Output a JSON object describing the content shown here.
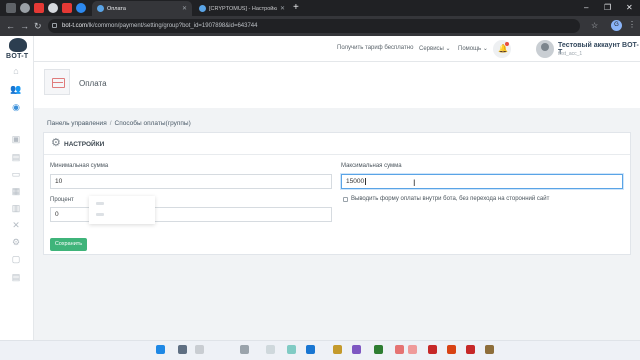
{
  "browser": {
    "tabs": [
      {
        "label": "Оплата",
        "active": true
      },
      {
        "label": "[CRYPTOMUS] - Настройка опл",
        "active": false
      }
    ],
    "url_host": "bot-t.com",
    "url_path": "/lk/common/payment/setting/group?bot_id=1907898&id=643744",
    "profile_initial": "G"
  },
  "sidebar": {
    "logo": "BOT-T",
    "icons": [
      "dashboard-icon",
      "users-icon",
      "globe-icon",
      "briefcase-icon",
      "document-icon",
      "layout-icon",
      "gift-icon",
      "chart-icon",
      "tools-icon",
      "settings-icon",
      "clipboard-icon",
      "report-icon"
    ]
  },
  "topnav": {
    "free_plan": "Получить тариф бесплатно",
    "services": "Сервисы",
    "help": "Помощь",
    "account_name": "Тестовый аккаунт BOT-T",
    "account_login": "test_acc_1"
  },
  "page": {
    "title": "Оплата"
  },
  "breadcrumb": {
    "home": "Панель управления",
    "separator": "/",
    "current": "Способы оплаты(группы)"
  },
  "settings": {
    "heading": "НАСТРОЙКИ",
    "min_label": "Минимальная сумма",
    "min_value": "10",
    "max_label": "Максимальная сумма",
    "max_value": "15000",
    "percent_label": "Процент",
    "percent_value": "0",
    "inline_form_label": "Выводить форму оплаты внутри бота, без перехода на сторонний сайт",
    "save": "Сохранить"
  },
  "colors": {
    "primary_green": "#3fb47a",
    "sidebar_active": "#3a8fd9",
    "notification_dot": "#e74c3c"
  }
}
